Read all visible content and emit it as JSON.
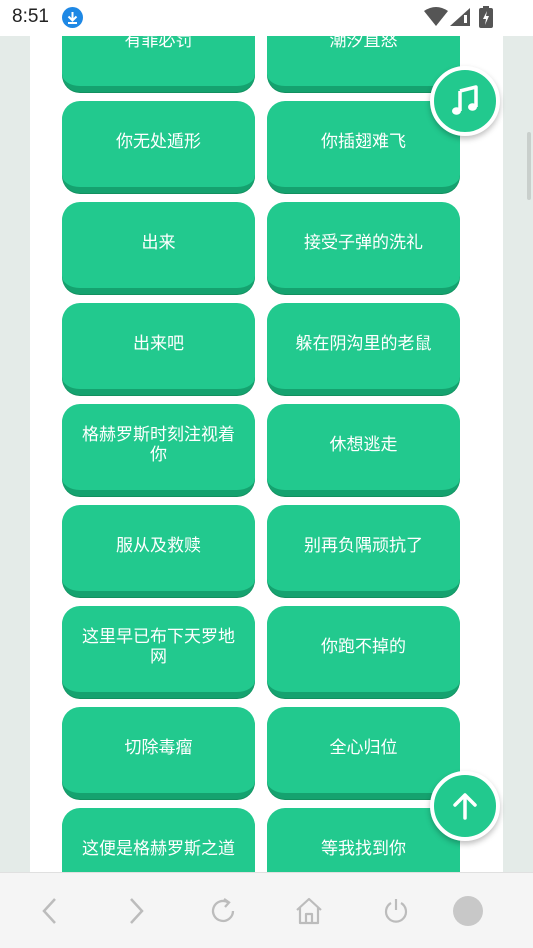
{
  "status": {
    "time": "8:51"
  },
  "icons": {
    "download": "download-icon",
    "wifi": "wifi-icon",
    "signal": "signal-icon",
    "battery": "battery-icon",
    "music": "music-note-icon",
    "up": "arrow-up-icon",
    "back": "chevron-left-icon",
    "forward": "chevron-right-icon",
    "refresh": "refresh-icon",
    "home": "home-icon",
    "power": "power-icon",
    "menu": "circle-icon"
  },
  "colors": {
    "card": "#22c98e",
    "card_shadow": "#15a26f",
    "background": "#e4ebe8"
  },
  "cards": [
    [
      "有罪必罚",
      "潮汐直怒"
    ],
    [
      "你无处遁形",
      "你插翅难飞"
    ],
    [
      "出来",
      "接受子弹的洗礼"
    ],
    [
      "出来吧",
      "躲在阴沟里的老鼠"
    ],
    [
      "格赫罗斯时刻注视着你",
      "休想逃走"
    ],
    [
      "服从及救赎",
      "别再负隅顽抗了"
    ],
    [
      "这里早已布下天罗地网",
      "你跑不掉的"
    ],
    [
      "切除毒瘤",
      "全心归位"
    ],
    [
      "这便是格赫罗斯之道",
      "等我找到你"
    ]
  ]
}
